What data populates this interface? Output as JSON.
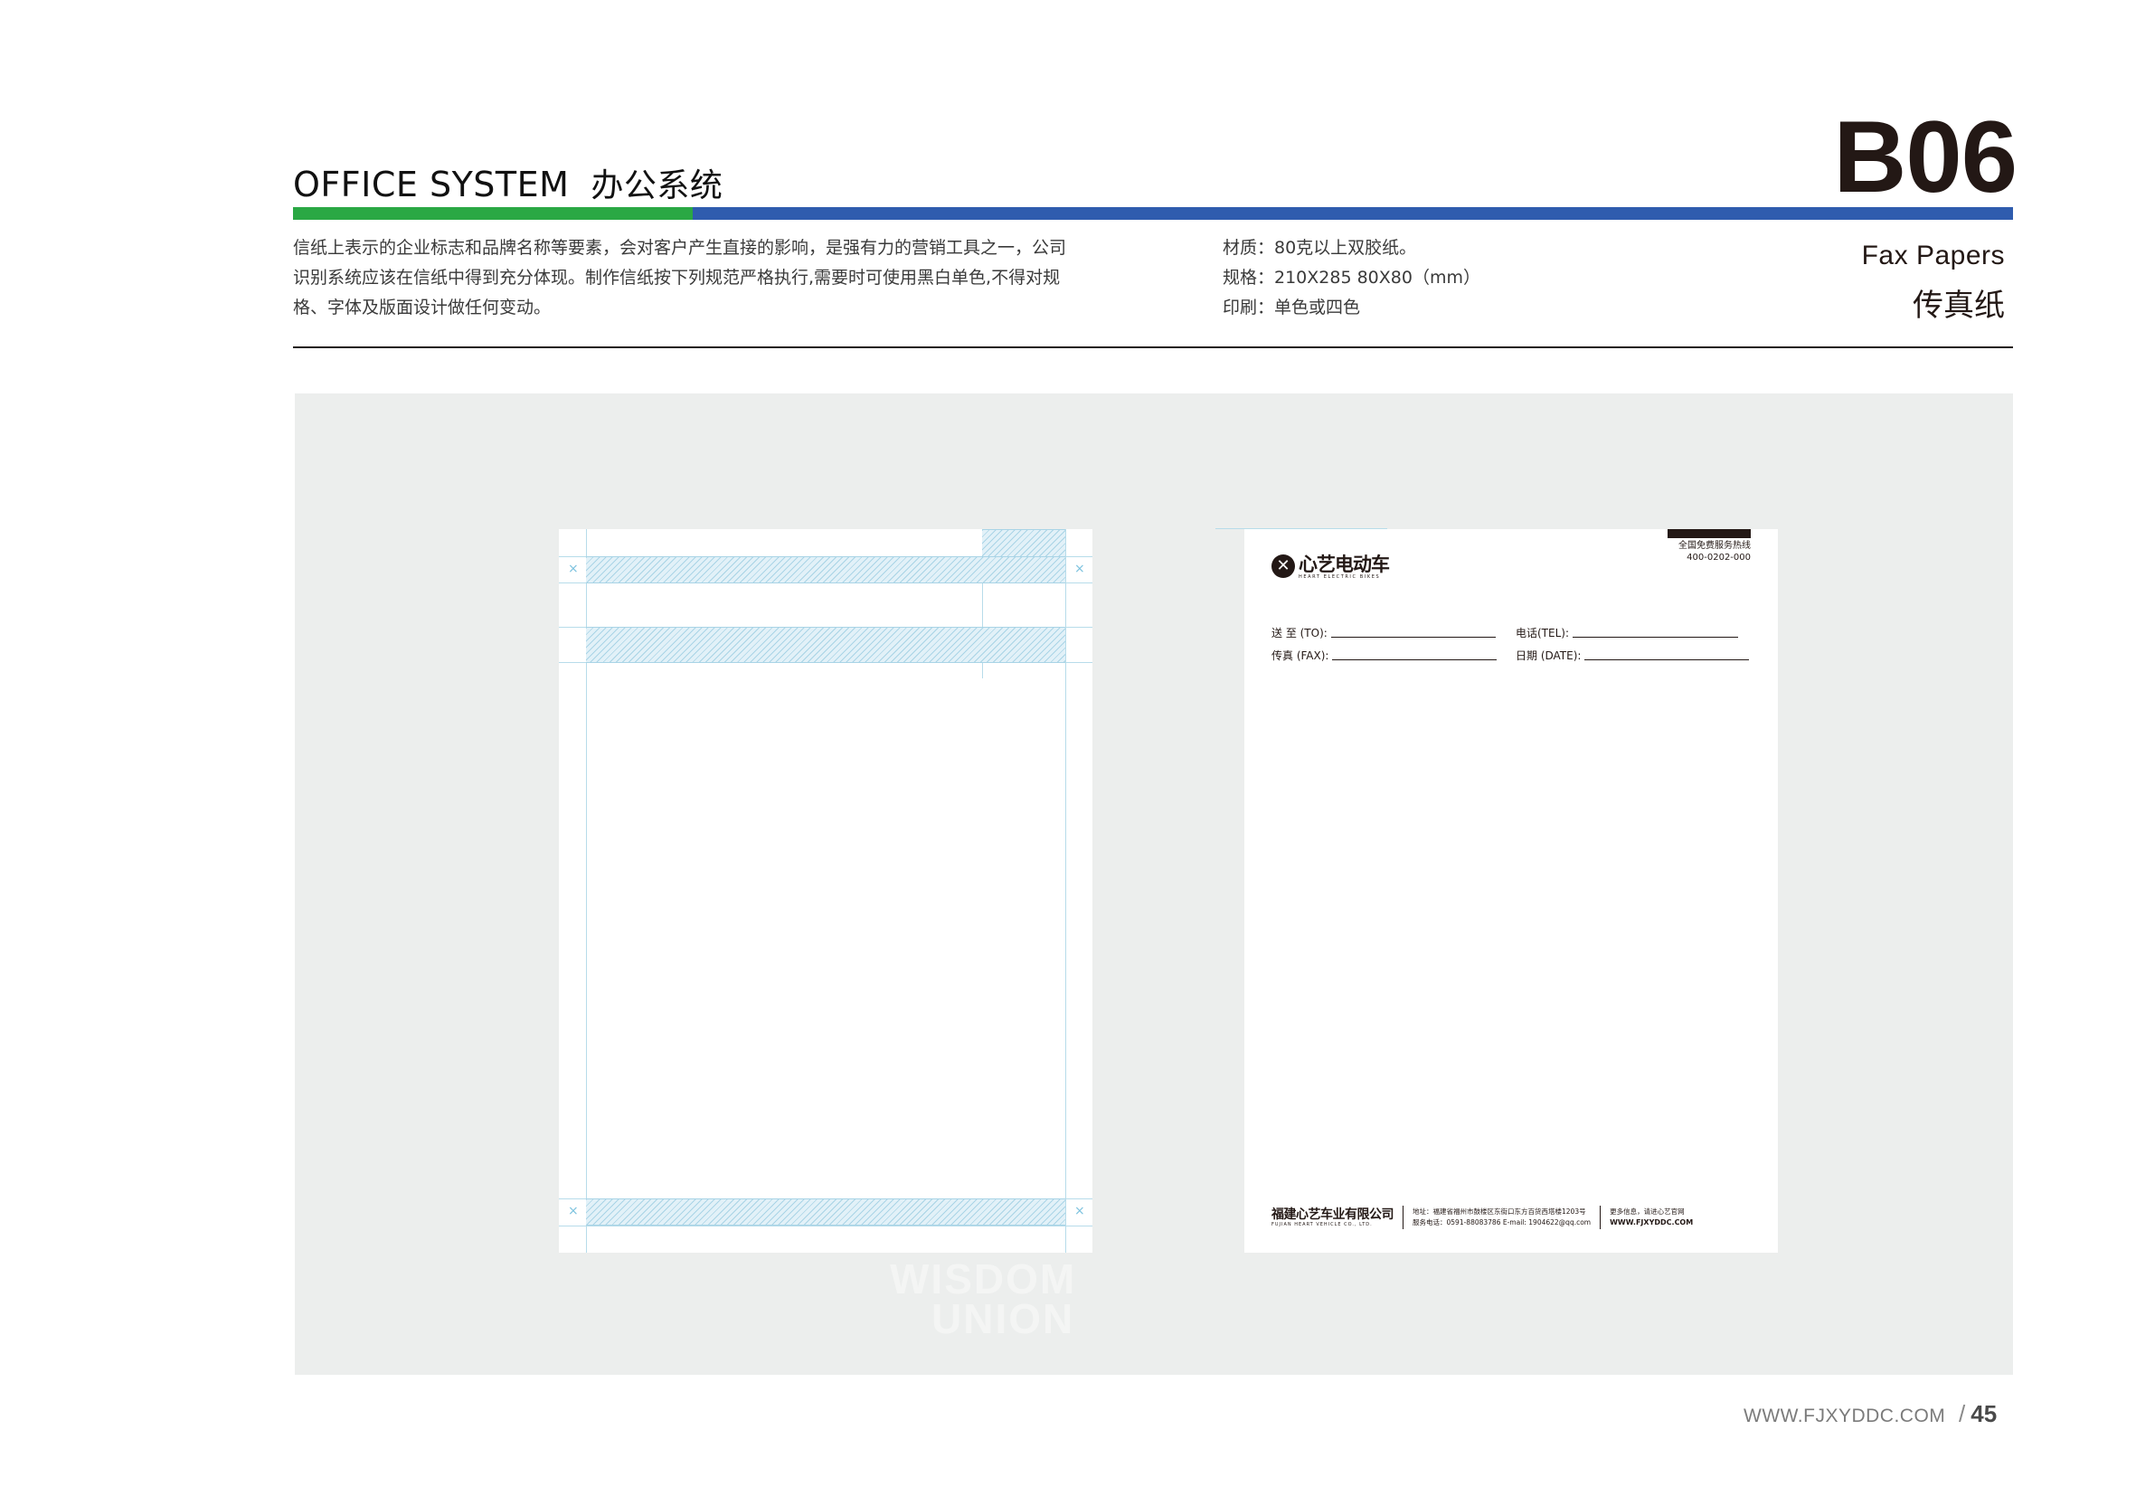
{
  "header": {
    "title_en": "OFFICE SYSTEM",
    "title_cn": "办公系统",
    "code": "B06",
    "colors": {
      "green": "#2aa844",
      "blue": "#2f5cae"
    }
  },
  "description": {
    "lines": [
      "信纸上表示的企业标志和品牌名称等要素，会对客户产生直接的影响，是强有力的营销工具之一，公司",
      "识别系统应该在信纸中得到充分体现。制作信纸按下列规范严格执行,需要时可使用黑白单色,不得对规",
      "格、字体及版面设计做任何变动。"
    ]
  },
  "specs": {
    "material": "材质：80克以上双胶纸。",
    "size": "规格：210X285  80X80（mm）",
    "print": "印刷：单色或四色"
  },
  "section": {
    "name_en": "Fax Papers",
    "name_cn": "传真纸"
  },
  "fax": {
    "hotline_label": "全国免费服务热线",
    "hotline_number": "400-0202-000",
    "logo_cn": "心艺电动车",
    "logo_en": "HEART ELECTRIC BIKES",
    "fields": {
      "to": "送 至 (TO):",
      "tel": "电话(TEL):",
      "fax": "传真 (FAX):",
      "date": "日期 (DATE):"
    },
    "footer": {
      "company_cn": "福建心艺车业有限公司",
      "company_en": "FUJIAN HEART VEHICLE CO., LTD.",
      "address": "地址：福建省福州市鼓楼区东街口东方百货西塔楼1203号",
      "contact": "服务电话：0591-88083786   E-mail: 1904622@qq.com",
      "more": "更多信息，请进心艺官网",
      "url": "WWW.FJXYDDC.COM"
    }
  },
  "watermark": {
    "line1": "WISDOM",
    "line2": "UNION"
  },
  "footer": {
    "site": "WWW.FJXYDDC.COM",
    "slash": "/",
    "page": "45"
  }
}
